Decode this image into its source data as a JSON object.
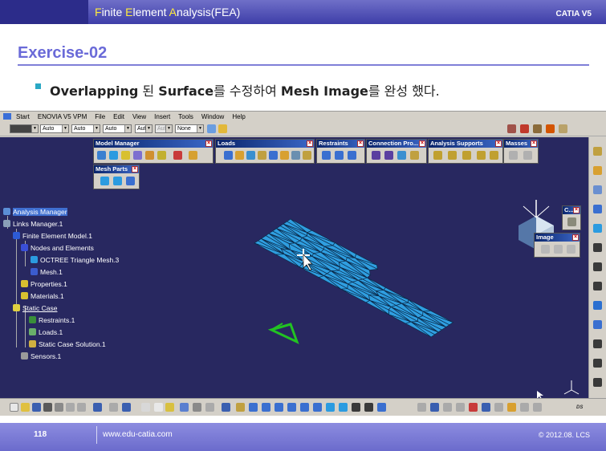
{
  "slide": {
    "top_title_parts": [
      "F",
      "inite ",
      "E",
      "lement ",
      "A",
      "nalysis(FEA)"
    ],
    "brand": "CATIA V5",
    "exercise_title": "Exercise-02",
    "subtitle_parts": [
      "Overlapping",
      " 된 ",
      "Surface",
      "를 수정하여 ",
      "Mesh Image",
      "를 완성 했다."
    ],
    "page_number": "118",
    "url": "www.edu-catia.com",
    "copyright": "© 2012.08. LCS"
  },
  "menubar": {
    "items": [
      "Start",
      "ENOVIA V5 VPM",
      "File",
      "Edit",
      "View",
      "Insert",
      "Tools",
      "Window",
      "Help"
    ]
  },
  "propbar": {
    "combos": [
      "",
      "Auto",
      "Auto",
      "Auto",
      "Aut",
      "Aut",
      "None"
    ]
  },
  "tree": {
    "nodes": [
      "Analysis Manager",
      "Links Manager.1",
      "Finite Element Model.1",
      "Nodes and Elements",
      "OCTREE Triangle Mesh.3",
      "Mesh.1",
      "Properties.1",
      "Materials.1",
      "Static Case",
      "Restraints.1",
      "Loads.1",
      "Static Case Solution.1",
      "Sensors.1"
    ]
  },
  "toolbars": {
    "model_manager": "Model Manager",
    "loads": "Loads",
    "restraints": "Restraints",
    "connection_properties": "Connection Pro...",
    "analysis_supports": "Analysis Supports",
    "masses": "Masses",
    "mesh_parts": "Mesh Parts",
    "c_bar": "C...",
    "image": "Image"
  },
  "colors": {
    "viewport_bg": "#282860",
    "mesh_fill": "#2f9ee0",
    "mesh_edge": "#0b2a4a",
    "toolbar_caption": "#0a246a",
    "slide_accent": "#6a6ad8"
  },
  "icons": {
    "cursor": "move-cursor-icon",
    "compass": "compass-icon",
    "axis": "xyz-axis-icon",
    "catia_logo": "catia-logo-icon",
    "restraint_marker": "clamp-symbol-icon"
  }
}
